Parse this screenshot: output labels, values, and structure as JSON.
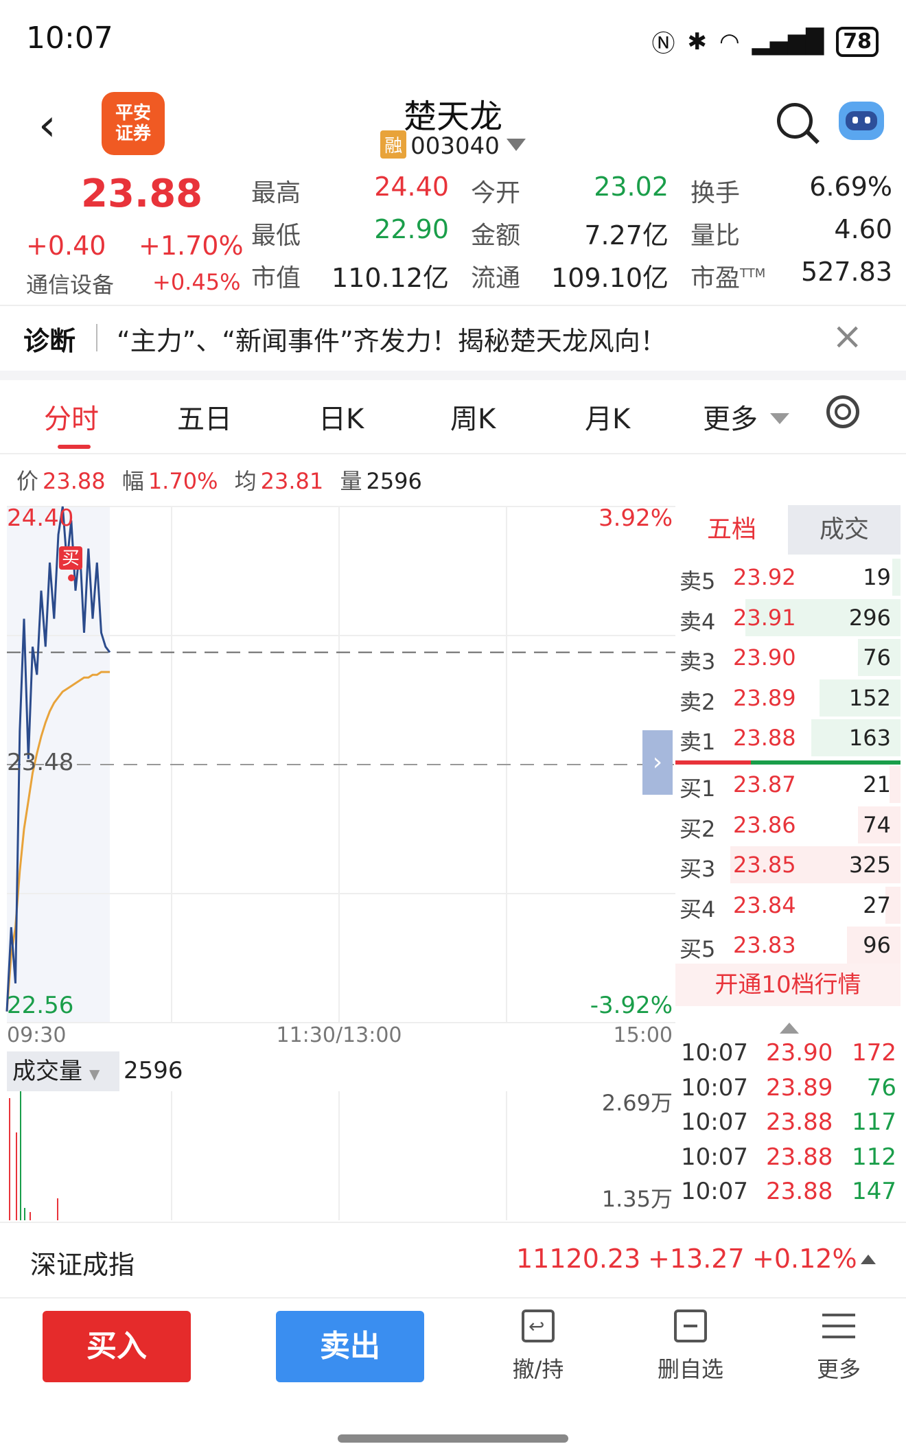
{
  "status": {
    "time": "10:07",
    "battery": "78"
  },
  "header": {
    "logo_text": "平安\n证券",
    "name": "楚天龙",
    "rong": "融",
    "code": "003040"
  },
  "quote": {
    "price": "23.88",
    "change": "+0.40",
    "change_pct": "+1.70%",
    "industry": "通信设备",
    "industry_pct": "+0.45%",
    "fields": [
      {
        "label": "最高",
        "value": "24.40",
        "color": "red"
      },
      {
        "label": "今开",
        "value": "23.02",
        "color": "green"
      },
      {
        "label": "换手",
        "value": "6.69%",
        "color": "black"
      },
      {
        "label": "最低",
        "value": "22.90",
        "color": "green"
      },
      {
        "label": "金额",
        "value": "7.27亿",
        "color": "black"
      },
      {
        "label": "量比",
        "value": "4.60",
        "color": "black"
      },
      {
        "label": "市值",
        "value": "110.12亿",
        "color": "black"
      },
      {
        "label": "流通",
        "value": "109.10亿",
        "color": "black"
      },
      {
        "label": "市盈",
        "value": "527.83",
        "color": "black",
        "sup": "TTM"
      }
    ]
  },
  "diagnosis": {
    "title": "诊断",
    "text": "“主力”、“新闻事件”齐发力！揭秘楚天龙风向！"
  },
  "tabs": [
    "分时",
    "五日",
    "日K",
    "周K",
    "月K",
    "更多"
  ],
  "info": {
    "price_label": "价",
    "price": "23.88",
    "amp_label": "幅",
    "amp": "1.70%",
    "avg_label": "均",
    "avg": "23.81",
    "vol_label": "量",
    "vol": "2596"
  },
  "chart_data": {
    "type": "line",
    "y_top": "24.40",
    "y_mid": "23.48",
    "y_bottom": "22.56",
    "pct_top": "3.92%",
    "pct_bottom": "-3.92%",
    "x_labels": [
      "09:30",
      "11:30/13:00",
      "15:00"
    ],
    "buy_marker": "买",
    "series": [
      {
        "values": [
          22.6,
          22.9,
          22.7,
          23.6,
          24.0,
          23.5,
          23.9,
          23.8,
          24.1,
          23.9,
          24.2,
          24.0,
          24.3,
          24.4,
          24.2,
          24.35,
          24.1,
          24.25,
          23.95,
          24.25,
          24.0,
          24.2,
          23.95,
          23.9,
          23.88
        ]
      },
      {
        "values": [
          22.6,
          22.8,
          22.9,
          23.1,
          23.25,
          23.35,
          23.45,
          23.52,
          23.58,
          23.63,
          23.67,
          23.7,
          23.72,
          23.74,
          23.75,
          23.76,
          23.77,
          23.78,
          23.79,
          23.79,
          23.8,
          23.8,
          23.81,
          23.81,
          23.81
        ]
      }
    ],
    "ylim": [
      22.56,
      24.4
    ],
    "prev_close": 23.48
  },
  "orderbook": {
    "tab_a": "五档",
    "tab_b": "成交",
    "asks": [
      {
        "level": "卖5",
        "price": "23.92",
        "vol": "19",
        "ratio": 0.04
      },
      {
        "level": "卖4",
        "price": "23.91",
        "vol": "296",
        "ratio": 0.73
      },
      {
        "level": "卖3",
        "price": "23.90",
        "vol": "76",
        "ratio": 0.2
      },
      {
        "level": "卖2",
        "price": "23.89",
        "vol": "152",
        "ratio": 0.38
      },
      {
        "level": "卖1",
        "price": "23.88",
        "vol": "163",
        "ratio": 0.42
      }
    ],
    "bids": [
      {
        "level": "买1",
        "price": "23.87",
        "vol": "21",
        "ratio": 0.05
      },
      {
        "level": "买2",
        "price": "23.86",
        "vol": "74",
        "ratio": 0.2
      },
      {
        "level": "买3",
        "price": "23.85",
        "vol": "325",
        "ratio": 0.8
      },
      {
        "level": "买4",
        "price": "23.84",
        "vol": "27",
        "ratio": 0.07
      },
      {
        "level": "买5",
        "price": "23.83",
        "vol": "96",
        "ratio": 0.25
      }
    ],
    "upgrade": "开通10档行情"
  },
  "ticks": [
    {
      "time": "10:07",
      "price": "23.90",
      "vol": "172",
      "vcolor": "red"
    },
    {
      "time": "10:07",
      "price": "23.89",
      "vol": "76",
      "vcolor": "green"
    },
    {
      "time": "10:07",
      "price": "23.88",
      "vol": "117",
      "vcolor": "green"
    },
    {
      "time": "10:07",
      "price": "23.88",
      "vol": "112",
      "vcolor": "green"
    },
    {
      "time": "10:07",
      "price": "23.88",
      "vol": "147",
      "vcolor": "green"
    }
  ],
  "volume": {
    "tab": "成交量",
    "value": "2596",
    "top": "2.69万",
    "mid": "1.35万"
  },
  "index": {
    "name": "深证成指",
    "value": "11120.23",
    "change": "+13.27",
    "pct": "+0.12%"
  },
  "bottom": {
    "buy": "买入",
    "sell": "卖出",
    "cancel": "撤/持",
    "remove": "删自选",
    "more": "更多"
  },
  "colors": {
    "up": "#e8333a",
    "down": "#1a9e4a",
    "price_line": "#2b4b8c",
    "avg_line": "#e8a33a"
  }
}
